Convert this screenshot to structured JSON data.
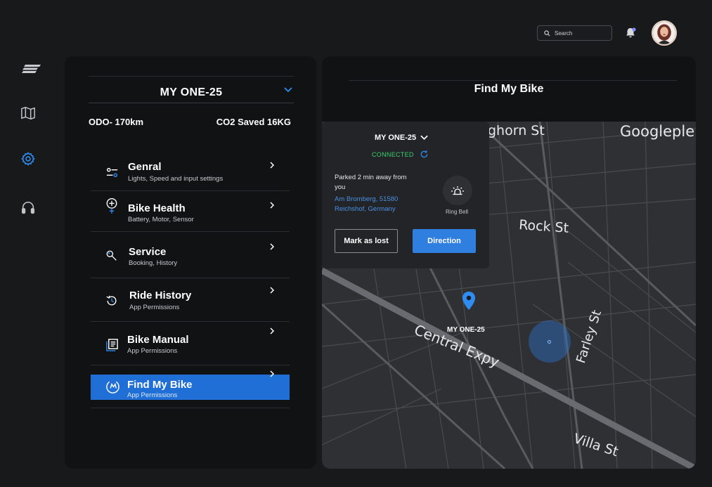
{
  "header": {
    "search_placeholder": "Search",
    "avatar_alt": "User avatar"
  },
  "rail": {
    "items": [
      {
        "icon": "logo-icon"
      },
      {
        "icon": "map-icon"
      },
      {
        "icon": "gear-icon",
        "active": true
      },
      {
        "icon": "headset-icon"
      }
    ]
  },
  "left_panel": {
    "bike_name": "MY ONE-25",
    "odo": "ODO- 170km",
    "co2": "CO2 Saved 16KG",
    "menu": [
      {
        "title": "Genral",
        "subtitle": "Lights, Speed and input settings",
        "icon": "sliders-icon"
      },
      {
        "title": "Bike Health",
        "subtitle": "Battery, Motor, Sensor",
        "icon": "health-icon"
      },
      {
        "title": "Service",
        "subtitle": "Booking, History",
        "icon": "wrench-icon"
      },
      {
        "title": "Ride History",
        "subtitle": "App Permissions",
        "icon": "history-icon"
      },
      {
        "title": "Bike Manual",
        "subtitle": "App Permissions",
        "icon": "manual-icon"
      },
      {
        "title": "Find My Bike",
        "subtitle": "App Permissions",
        "icon": "locate-icon",
        "active": true
      }
    ]
  },
  "right_panel": {
    "title": "Find My Bike",
    "card": {
      "bike_name": "MY ONE-25",
      "status": "CONNECTED",
      "parked_text": "Parked 2 min away from you",
      "address": "Am Bromberg, 51580 Reichshof, Germany",
      "ring_label": "Ring Bell",
      "mark_lost_label": "Mark as lost",
      "direction_label": "Direction"
    },
    "map": {
      "pin_label": "MY ONE-25",
      "streets": [
        "Googleple",
        "ghorn St",
        "Rock St",
        "Central Expy",
        "Farley St",
        "Villa St"
      ]
    }
  },
  "colors": {
    "accent": "#1f6fd6",
    "connected": "#3bd16f",
    "background": "#18191b",
    "panel": "#111214"
  }
}
